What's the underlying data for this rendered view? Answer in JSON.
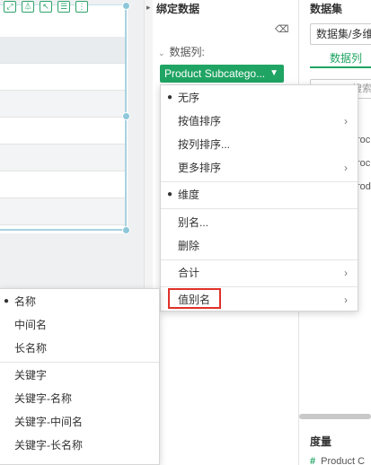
{
  "binding_panel": {
    "title": "绑定数据",
    "field_label": "数据列:",
    "field_value": "Product Subcatego...",
    "dropdown_icon": "caret-down-icon",
    "clear_icon": "eraser-icon"
  },
  "dataset_panel": {
    "title": "数据集",
    "selected_dataset": "数据集/多维",
    "tab_columns": "数据列",
    "search_placeholder": "搜索",
    "tree_items": [
      "roc",
      "roc",
      "rod"
    ],
    "measures_title": "度量",
    "measure_item": "Product C"
  },
  "context_menu": {
    "items": [
      {
        "label": "无序",
        "checked": true,
        "submenu": false
      },
      {
        "label": "按值排序",
        "checked": false,
        "submenu": true
      },
      {
        "label": "按列排序...",
        "checked": false,
        "submenu": false
      },
      {
        "label": "更多排序",
        "checked": false,
        "submenu": true
      },
      {
        "label": "维度",
        "checked": true,
        "submenu": false
      },
      {
        "label": "别名...",
        "checked": false,
        "submenu": false
      },
      {
        "label": "删除",
        "checked": false,
        "submenu": false
      },
      {
        "label": "合计",
        "checked": false,
        "submenu": true
      },
      {
        "label": "值别名",
        "checked": false,
        "submenu": true,
        "highlighted": true
      }
    ]
  },
  "value_alias_submenu": {
    "items": [
      {
        "label": "名称",
        "checked": true
      },
      {
        "label": "中间名",
        "checked": false
      },
      {
        "label": "长名称",
        "checked": false
      },
      {
        "label": "关键字",
        "checked": false
      },
      {
        "label": "关键字-名称",
        "checked": false
      },
      {
        "label": "关键字-中间名",
        "checked": false
      },
      {
        "label": "关键字-长名称",
        "checked": false
      }
    ]
  },
  "colors": {
    "accent_green": "#1fa463",
    "highlight_red": "#e0302a",
    "selection_blue": "#8ec7d9"
  }
}
